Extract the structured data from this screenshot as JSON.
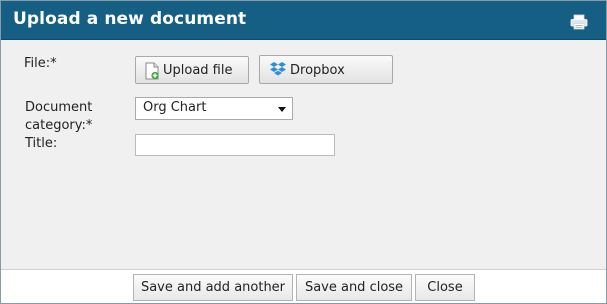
{
  "dialog": {
    "title": "Upload a new document",
    "print_icon": "print-icon"
  },
  "form": {
    "file_label": "File:*",
    "upload_button_label": "Upload file",
    "upload_icon": "document-add-icon",
    "dropbox_button_label": "Dropbox",
    "dropbox_icon": "dropbox-icon",
    "category_label_line1": "Document",
    "category_label_line2": "category:*",
    "category_selected": "Org Chart",
    "title_label": "Title:",
    "title_value": ""
  },
  "footer": {
    "save_add_label": "Save and add another",
    "save_close_label": "Save and close",
    "close_label": "Close"
  },
  "colors": {
    "titlebar": "#155f85",
    "body": "#f0f0f0"
  }
}
